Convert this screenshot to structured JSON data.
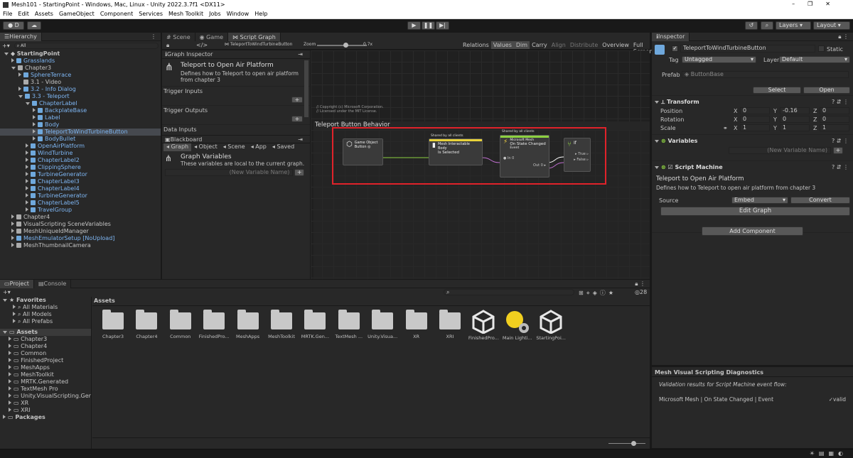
{
  "window": {
    "title": "Mesh101 - StartingPoint - Windows, Mac, Linux - Unity 2022.3.7f1 <DX11>"
  },
  "menu": [
    "File",
    "Edit",
    "Assets",
    "GameObject",
    "Component",
    "Services",
    "Mesh Toolkit",
    "Jobs",
    "Window",
    "Help"
  ],
  "toolbar": {
    "account": "D",
    "layers": "Layers",
    "layout": "Layout"
  },
  "hierarchy": {
    "tab": "Hierarchy",
    "search_placeholder": "All",
    "rows": [
      {
        "label": "StartingPoint",
        "depth": 0,
        "bold": true,
        "open": true,
        "blue": false
      },
      {
        "label": "Grasslands",
        "depth": 1,
        "blue": true
      },
      {
        "label": "Chapter3",
        "depth": 1,
        "open": true,
        "blue": false
      },
      {
        "label": "SphereTerrace",
        "depth": 2,
        "blue": true
      },
      {
        "label": "3.1 - Video",
        "depth": 2,
        "blue": false
      },
      {
        "label": "3.2 - Info Dialog",
        "depth": 2,
        "blue": true
      },
      {
        "label": "3.3 - Teleport",
        "depth": 2,
        "blue": true,
        "open": true
      },
      {
        "label": "ChapterLabel",
        "depth": 3,
        "blue": true,
        "open": true
      },
      {
        "label": "BackplateBase",
        "depth": 4,
        "blue": true
      },
      {
        "label": "Label",
        "depth": 4,
        "blue": true
      },
      {
        "label": "Body",
        "depth": 4,
        "blue": true
      },
      {
        "label": "TeleportToWindTurbineButton",
        "depth": 4,
        "blue": true,
        "selected": true
      },
      {
        "label": "BodyBullet",
        "depth": 4,
        "blue": true
      },
      {
        "label": "OpenAirPlatform",
        "depth": 3,
        "blue": true
      },
      {
        "label": "WindTurbine",
        "depth": 3,
        "blue": true
      },
      {
        "label": "ChapterLabel2",
        "depth": 3,
        "blue": true
      },
      {
        "label": "ClippingSphere",
        "depth": 3,
        "blue": true
      },
      {
        "label": "TurbineGenerator",
        "depth": 3,
        "blue": true
      },
      {
        "label": "ChapterLabel3",
        "depth": 3,
        "blue": true
      },
      {
        "label": "ChapterLabel4",
        "depth": 3,
        "blue": true
      },
      {
        "label": "TurbineGenerator",
        "depth": 3,
        "blue": true
      },
      {
        "label": "ChapterLabel5",
        "depth": 3,
        "blue": true
      },
      {
        "label": "TravelGroup",
        "depth": 3,
        "blue": true
      },
      {
        "label": "Chapter4",
        "depth": 1,
        "blue": false
      },
      {
        "label": "VisualScripting SceneVariables",
        "depth": 1,
        "blue": false
      },
      {
        "label": "MeshUniqueIdManager",
        "depth": 1,
        "blue": false
      },
      {
        "label": "MeshEmulatorSetup [NoUpload]",
        "depth": 1,
        "blue": true
      },
      {
        "label": "MeshThumbnailCamera",
        "depth": 1,
        "blue": false
      }
    ]
  },
  "center_tabs": [
    "Scene",
    "Game",
    "Script Graph"
  ],
  "graph_toolbar": {
    "breadcrumb": "TeleportToWindTurbineButton",
    "zoom_label": "Zoom",
    "zoom_value": "0.7x",
    "buttons": [
      "Relations",
      "Values",
      "Dim",
      "Carry",
      "Align",
      "Distribute",
      "Overview",
      "Full Screen"
    ]
  },
  "graph_inspector": {
    "title": "Graph Inspector",
    "name": "Teleport to Open Air Platform",
    "description": "Defines how to Teleport to open air platform from chapter 3",
    "trigger_inputs": "Trigger Inputs",
    "trigger_outputs": "Trigger Outputs",
    "data_inputs": "Data Inputs"
  },
  "blackboard": {
    "title": "Blackboard",
    "tabs": [
      "Graph",
      "Object",
      "Scene",
      "App",
      "Saved"
    ],
    "heading": "Graph Variables",
    "subtitle": "These variables are local to the current graph.",
    "new_var": "(New Variable Name)"
  },
  "graph": {
    "copyright1": "// Copyright (c) Microsoft Corporation.",
    "copyright2": "// Licensed under the MIT License.",
    "group_title": "Teleport Button Behavior",
    "node1": {
      "title": "Game Object",
      "sub": "Button"
    },
    "node2": {
      "shared": "Shared by all clients",
      "title": "Mesh Interactable Body",
      "sub": "Is Selected"
    },
    "node3": {
      "shared": "Shared by all clients",
      "title": "Microsoft Mesh",
      "sub": "On State Changed",
      "sub2": "Event",
      "in": "In 0",
      "out": "Out 0"
    },
    "node4": {
      "title": "If",
      "true": "True",
      "false": "False"
    }
  },
  "inspector": {
    "tab": "Inspector",
    "object": "TeleportToWindTurbineButton",
    "static": "Static",
    "tag_label": "Tag",
    "tag": "Untagged",
    "layer_label": "Layer",
    "layer": "Default",
    "prefab_label": "Prefab",
    "prefab": "ButtonBase",
    "select": "Select",
    "open": "Open",
    "transform": "Transform",
    "position": "Position",
    "rotation": "Rotation",
    "scale": "Scale",
    "pos": [
      "0",
      "-0.16",
      "0"
    ],
    "rot": [
      "0",
      "0",
      "0"
    ],
    "scl": [
      "1",
      "1",
      "1"
    ],
    "variables": "Variables",
    "new_var": "(New Variable Name)",
    "script_machine": "Script Machine",
    "sm_title": "Teleport to Open Air Platform",
    "sm_desc": "Defines how to Teleport to open air platform from chapter 3",
    "source_label": "Source",
    "source": "Embed",
    "convert": "Convert",
    "edit_graph": "Edit Graph",
    "add_component": "Add Component"
  },
  "diagnostics": {
    "title": "Mesh Visual Scripting Diagnostics",
    "subtitle": "Validation results for Script Machine event flow:",
    "entry": "Microsoft Mesh | On State Changed | Event",
    "status": "valid"
  },
  "project": {
    "tabs": [
      "Project",
      "Console"
    ],
    "count": "28",
    "favorites": "Favorites",
    "fav_items": [
      "All Materials",
      "All Models",
      "All Prefabs"
    ],
    "assets_root": "Assets",
    "tree": [
      "Chapter3",
      "Chapter4",
      "Common",
      "FinishedProject",
      "MeshApps",
      "MeshToolkit",
      "MRTK.Generated",
      "TextMesh Pro",
      "Unity.VisualScripting.Genera",
      "XR",
      "XRI"
    ],
    "packages": "Packages",
    "crumb": "Assets",
    "items": [
      {
        "label": "Chapter3",
        "kind": "folder"
      },
      {
        "label": "Chapter4",
        "kind": "folder"
      },
      {
        "label": "Common",
        "kind": "folder"
      },
      {
        "label": "FinishedPro...",
        "kind": "folder"
      },
      {
        "label": "MeshApps",
        "kind": "folder"
      },
      {
        "label": "MeshToolkit",
        "kind": "folder"
      },
      {
        "label": "MRTK.Gen...",
        "kind": "folder"
      },
      {
        "label": "TextMesh ...",
        "kind": "folder"
      },
      {
        "label": "Unity.Visua...",
        "kind": "folder"
      },
      {
        "label": "XR",
        "kind": "folder"
      },
      {
        "label": "XRI",
        "kind": "folder"
      },
      {
        "label": "FinishedPro...",
        "kind": "unity"
      },
      {
        "label": "Main Lighti...",
        "kind": "light"
      },
      {
        "label": "StartingPoi...",
        "kind": "unity"
      }
    ]
  },
  "colors": {
    "accent": "#2c5d87",
    "highlight": "#e0222a",
    "selected": "#2c5d87"
  }
}
